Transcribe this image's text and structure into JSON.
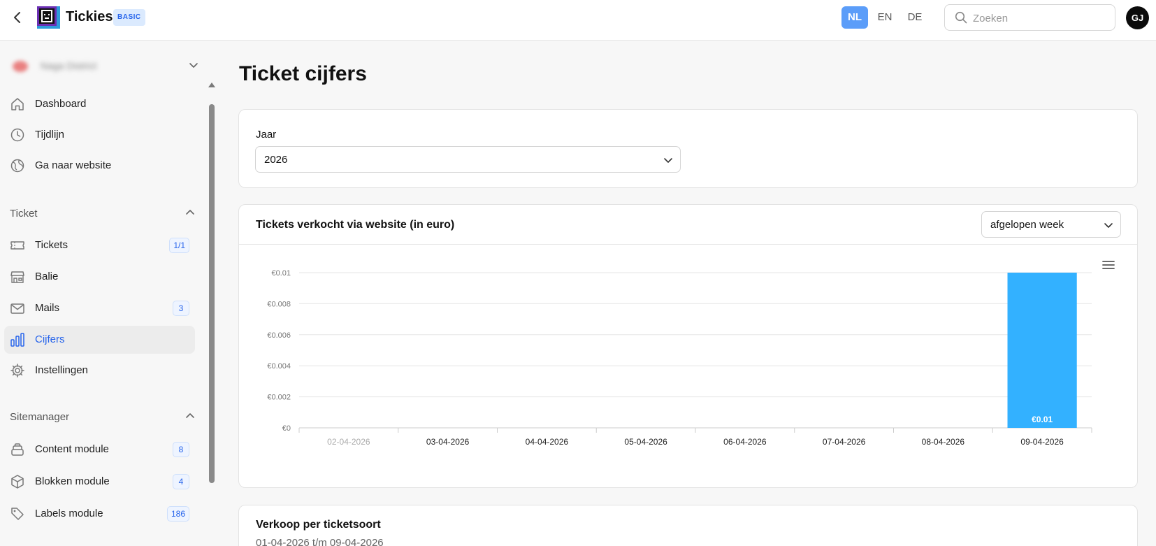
{
  "app": {
    "title": "Tickies",
    "plan": "BASIC"
  },
  "languages": [
    {
      "code": "NL",
      "active": true
    },
    {
      "code": "EN",
      "active": false
    },
    {
      "code": "DE",
      "active": false
    }
  ],
  "search": {
    "placeholder": "Zoeken"
  },
  "user": {
    "initials": "GJ"
  },
  "sidebar": {
    "org_name": "Naga District",
    "top_items": [
      {
        "label": "Dashboard",
        "icon": "home-icon"
      },
      {
        "label": "Tijdlijn",
        "icon": "clock-icon"
      },
      {
        "label": "Ga naar website",
        "icon": "globe-icon"
      }
    ],
    "sections": [
      {
        "title": "Ticket",
        "items": [
          {
            "label": "Tickets",
            "icon": "ticket-icon",
            "count": "1/1"
          },
          {
            "label": "Balie",
            "icon": "store-icon",
            "count": ""
          },
          {
            "label": "Mails",
            "icon": "mail-icon",
            "count": "3"
          },
          {
            "label": "Cijfers",
            "icon": "bar-chart-icon",
            "count": "",
            "active": true
          },
          {
            "label": "Instellingen",
            "icon": "gear-icon",
            "count": ""
          }
        ]
      },
      {
        "title": "Sitemanager",
        "items": [
          {
            "label": "Content module",
            "icon": "layers-icon",
            "count": "8"
          },
          {
            "label": "Blokken module",
            "icon": "cube-icon",
            "count": "4"
          },
          {
            "label": "Labels module",
            "icon": "tag-icon",
            "count": "186"
          }
        ]
      }
    ]
  },
  "main": {
    "page_title": "Ticket cijfers",
    "year_filter": {
      "label": "Jaar",
      "value": "2026"
    },
    "chart_card": {
      "title": "Tickets verkocht via website (in euro)",
      "period": "afgelopen week"
    },
    "sales_card": {
      "title": "Verkoop per ticketsoort",
      "range": "01-04-2026 t/m 09-04-2026"
    }
  },
  "chart_data": {
    "type": "bar",
    "title": "Tickets verkocht via website (in euro)",
    "categories": [
      "02-04-2026",
      "03-04-2026",
      "04-04-2026",
      "05-04-2026",
      "06-04-2026",
      "07-04-2026",
      "08-04-2026",
      "09-04-2026"
    ],
    "values": [
      0,
      0,
      0,
      0,
      0,
      0,
      0,
      0.01
    ],
    "data_labels": [
      "",
      "",
      "",
      "",
      "",
      "",
      "",
      "€0.01"
    ],
    "y_ticks": [
      "€0",
      "€0.002",
      "€0.004",
      "€0.006",
      "€0.008",
      "€0.01"
    ],
    "ylim": [
      0,
      0.01
    ],
    "grid": true,
    "bar_color": "#33b1ff",
    "muted_category_color": "#aaaaaa"
  }
}
